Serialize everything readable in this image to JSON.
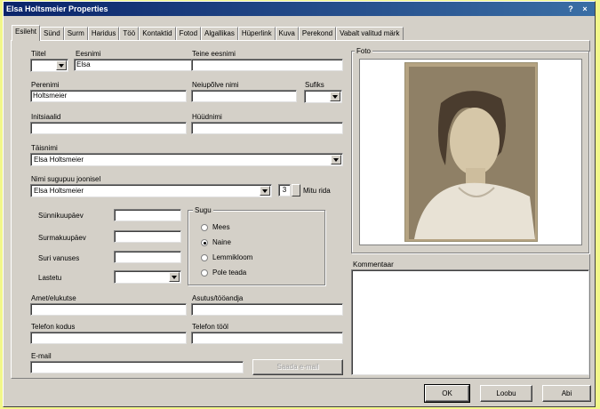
{
  "window": {
    "title": "Elsa Holtsmeier Properties",
    "help_glyph": "?",
    "close_glyph": "×"
  },
  "tabs": [
    "Esileht",
    "Sünd",
    "Surm",
    "Haridus",
    "Töö",
    "Kontaktid",
    "Fotod",
    "Algallikas",
    "Hüperlink",
    "Kuva",
    "Perekond",
    "Vabalt valitud märk"
  ],
  "form": {
    "titel_label": "Tiitel",
    "titel_value": "",
    "eesnimi_label": "Eesnimi",
    "eesnimi_value": "Elsa",
    "teine_eesnimi_label": "Teine eesnimi",
    "teine_eesnimi_value": "",
    "perenimi_label": "Perenimi",
    "perenimi_value": "Holtsmeier",
    "neiupolve_label": "Neiupõlve nimi",
    "neiupolve_value": "",
    "sufiks_label": "Sufiks",
    "sufiks_value": "",
    "initsiaalid_label": "Initsiaalid",
    "initsiaalid_value": "",
    "hyydnimi_label": "Hüüdnimi",
    "hyydnimi_value": "",
    "taisnimi_label": "Täisnimi",
    "taisnimi_value": "Elsa Holtsmeier",
    "nimi_puul_label": "Nimi sugupuu joonisel",
    "nimi_puul_value": "Elsa Holtsmeier",
    "rows_value": "3",
    "rows_label": "Mitu rida",
    "synnikuupaev_label": "Sünnikuupäev",
    "synnikuupaev_value": "",
    "surmakuupaev_label": "Surmakuupäev",
    "surmakuupaev_value": "",
    "suri_vanuses_label": "Suri vanuses",
    "suri_vanuses_value": "",
    "lastetu_label": "Lastetu",
    "lastetu_value": "",
    "amet_label": "Amet/elukutse",
    "amet_value": "",
    "asutus_label": "Asutus/tööandja",
    "asutus_value": "",
    "tel_kodus_label": "Telefon kodus",
    "tel_kodus_value": "",
    "tel_tool_label": "Telefon tööl",
    "tel_tool_value": "",
    "email_label": "E-mail",
    "email_value": "",
    "saada_email_label": "Saada e-mail"
  },
  "sugu": {
    "label": "Sugu",
    "options": [
      "Mees",
      "Naine",
      "Lemmikloom",
      "Pole teada"
    ],
    "selected": "Naine"
  },
  "photo_panel": {
    "label": "Foto"
  },
  "comment_panel": {
    "label": "Kommentaar",
    "value": ""
  },
  "footer": {
    "ok_label": "OK",
    "cancel_label": "Loobu",
    "help_label": "Abi"
  }
}
